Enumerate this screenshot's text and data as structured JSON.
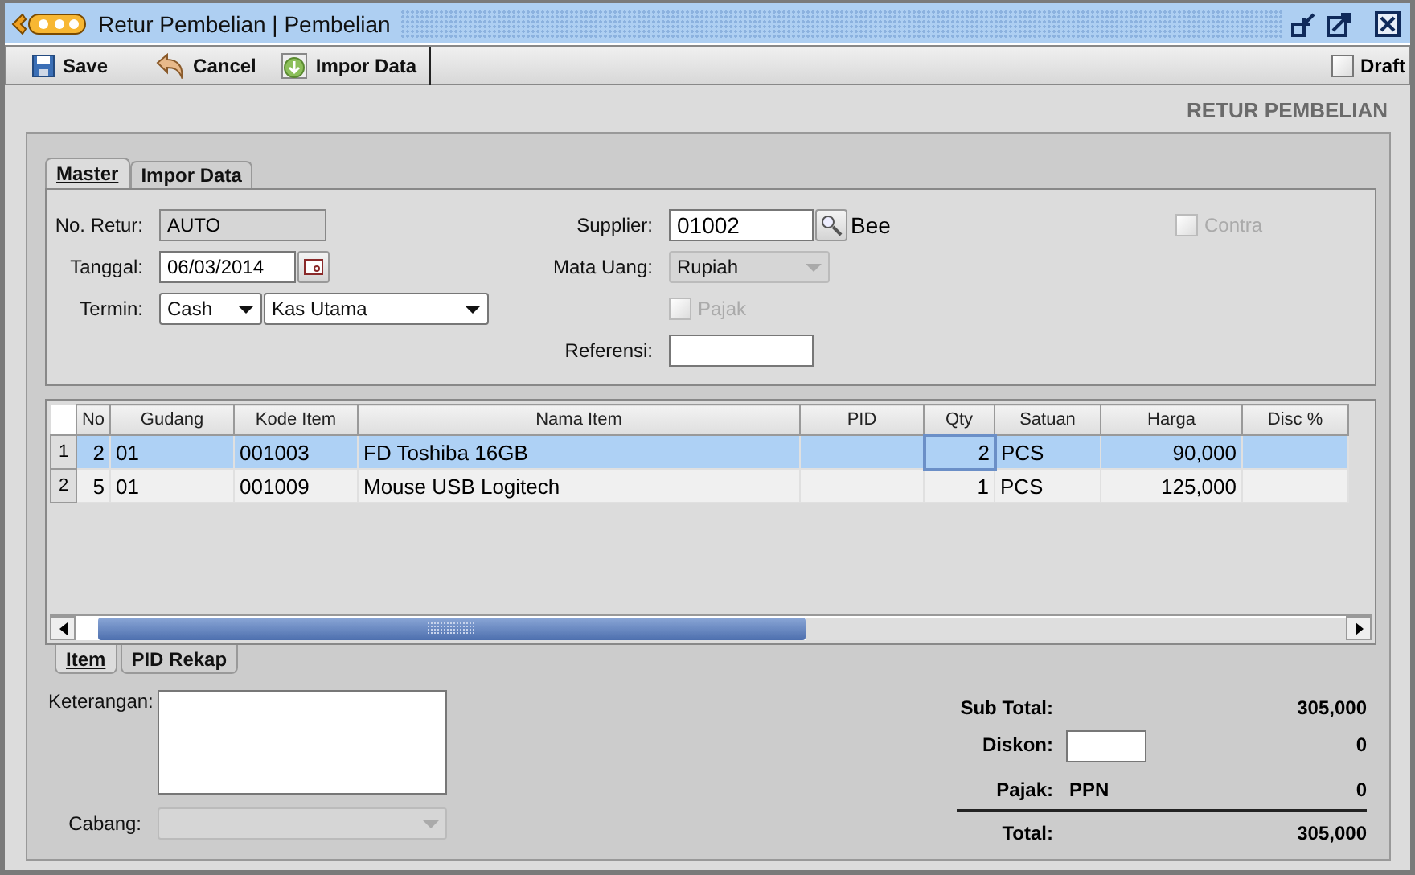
{
  "window": {
    "title": "Retur Pembelian | Pembelian"
  },
  "toolbar": {
    "buttons": [
      {
        "kind": "save",
        "label": "Save"
      },
      {
        "kind": "cancel",
        "label": "Cancel"
      },
      {
        "kind": "import",
        "label": "Impor Data"
      }
    ],
    "draft": {
      "label": "Draft",
      "checked": false
    }
  },
  "header_title": "RETUR PEMBELIAN",
  "tabs": [
    {
      "label": "Master",
      "selected": true
    },
    {
      "label": "Impor Data",
      "selected": false
    }
  ],
  "form": {
    "no_retur": {
      "label": "No. Retur:",
      "value": "AUTO"
    },
    "tanggal": {
      "label": "Tanggal:",
      "value": "06/03/2014"
    },
    "termin": {
      "label": "Termin:",
      "value": "Cash",
      "account": "Kas Utama"
    },
    "supplier": {
      "label": "Supplier:",
      "value": "01002",
      "name": "Bee"
    },
    "mata_uang": {
      "label": "Mata Uang:",
      "value": "Rupiah",
      "disabled": true
    },
    "pajak": {
      "label": "Pajak",
      "checked": false,
      "disabled": true
    },
    "referensi": {
      "label": "Referensi:"
    },
    "contra": {
      "label": "Contra",
      "checked": false,
      "disabled": true
    }
  },
  "table": {
    "columns": [
      "No",
      "Gudang",
      "Kode Item",
      "Nama Item",
      "PID",
      "Qty",
      "Satuan",
      "Harga",
      "Disc %"
    ],
    "rows": [
      {
        "row_header": "1",
        "selected": true,
        "cells": [
          "2",
          "01",
          "001003",
          "FD Toshiba 16GB",
          "",
          "2",
          "PCS",
          "90,000",
          ""
        ]
      },
      {
        "row_header": "2",
        "selected": false,
        "cells": [
          "5",
          "01",
          "001009",
          "Mouse USB Logitech",
          "",
          "1",
          "PCS",
          "125,000",
          ""
        ]
      }
    ]
  },
  "bottom_tabs": [
    {
      "label": "Item",
      "selected": true
    },
    {
      "label": "PID Rekap",
      "selected": false
    }
  ],
  "keterangan": {
    "label": "Keterangan:"
  },
  "cabang": {
    "label": "Cabang:"
  },
  "totals": {
    "sub_total": {
      "label": "Sub Total:",
      "value": "305,000"
    },
    "diskon": {
      "label": "Diskon:",
      "value": "0"
    },
    "pajak": {
      "label": "Pajak:",
      "type": "PPN",
      "value": "0"
    },
    "total": {
      "label": "Total:",
      "value": "305,000"
    }
  }
}
